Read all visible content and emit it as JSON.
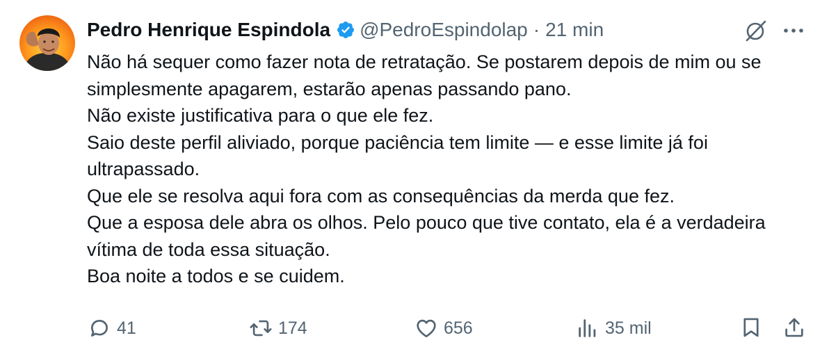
{
  "author": {
    "name": "Pedro Henrique Espindola",
    "handle": "@PedroEspindolap",
    "separator": "·",
    "time": "21 min"
  },
  "tweet": {
    "paragraphs": [
      "Não há sequer como fazer nota de retratação. Se postarem depois de mim ou se simplesmente apagarem, estarão apenas passando pano.",
      "Não existe justificativa para o que ele fez.",
      "Saio deste perfil aliviado, porque paciência tem limite — e esse limite já foi ultrapassado.",
      "Que ele se resolva aqui fora com as consequências da merda que fez.",
      "Que a esposa dele abra os olhos. Pelo pouco que tive contato, ela é a verdadeira vítima de toda essa situação.",
      "Boa noite a todos e se cuidem."
    ]
  },
  "actions": {
    "replies": "41",
    "retweets": "174",
    "likes": "656",
    "views": "35 mil"
  },
  "icons": {
    "verified": "verified-badge-icon",
    "grok": "grok-icon",
    "more": "more-icon",
    "reply": "reply-icon",
    "retweet": "retweet-icon",
    "like": "heart-icon",
    "views": "views-icon",
    "bookmark": "bookmark-icon",
    "share": "share-icon"
  },
  "colors": {
    "text": "#0f1419",
    "secondary": "#536471",
    "verified": "#1d9bf0",
    "avatar_bg": "#f07a14"
  }
}
